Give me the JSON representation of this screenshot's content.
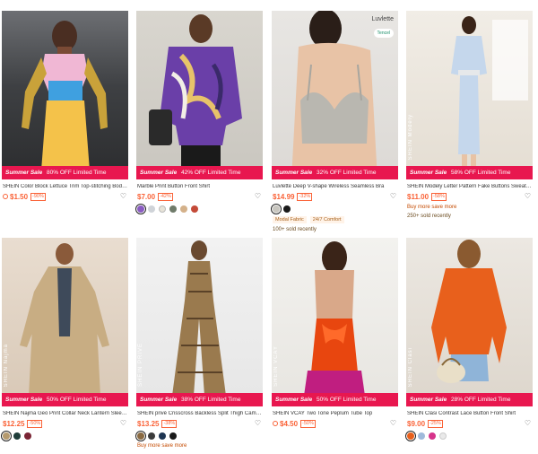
{
  "products": [
    {
      "banner_sale": "Summer Sale",
      "banner_off": "80% OFF Limited Time",
      "title": "SHEIN Color Block Lettuce Trim Top-stitching Bodycon ...",
      "price": "$1.50",
      "discount": "-90%",
      "flash": true,
      "swatches": [],
      "tags": [],
      "link": "",
      "sold": ""
    },
    {
      "banner_sale": "Summer Sale",
      "banner_off": "42% OFF Limited Time",
      "title": "Marble Print Button Front Shirt",
      "price": "$7.00",
      "discount": "-42%",
      "flash": false,
      "swatches": [
        "#8a5cc2",
        "#cfd3d8",
        "#e7e3d8",
        "#6f7b6a",
        "#d4b18a",
        "#c44a38"
      ],
      "tags": [],
      "link": "",
      "sold": ""
    },
    {
      "banner_sale": "Summer Sale",
      "banner_off": "32% OFF Limited Time",
      "title": "Luvlette Deep V-shape Wireless Seamless Bra",
      "price": "$14.99",
      "discount": "-32%",
      "flash": false,
      "swatches": [
        "#c8c6bf",
        "#1a1a1a"
      ],
      "tags": [
        "Modal Fabric",
        "24/7 Comfort"
      ],
      "link": "",
      "sold": "100+ sold recently",
      "brand_logo": "Luvlette",
      "logo_chip": "Tencel"
    },
    {
      "banner_sale": "Summer Sale",
      "banner_off": "58% OFF Limited Time",
      "title": "SHEIN Modely Letter Pattern Fake Buttons Sweater Dress",
      "price": "$11.00",
      "discount": "-58%",
      "flash": false,
      "swatches": [],
      "tags": [],
      "link": "Buy more save more",
      "sold": "250+ sold recently",
      "brandmark": "SHEIN Modely"
    },
    {
      "banner_sale": "Summer Sale",
      "banner_off": "50% OFF Limited Time",
      "title": "SHEIN Najma Geo Print Collar Neck Lantern Sleeve Kaf...",
      "price": "$12.25",
      "discount": "-50%",
      "flash": false,
      "swatches": [
        "#b59a6e",
        "#1f3d3a",
        "#7a2434"
      ],
      "tags": [],
      "link": "",
      "sold": "",
      "brandmark": "SHEIN Najma"
    },
    {
      "banner_sale": "Summer Sale",
      "banner_off": "38% OFF Limited Time",
      "title": "SHEIN privé Crisscross Backless Split Thigh Cami Jum...",
      "price": "$13.25",
      "discount": "-38%",
      "flash": false,
      "swatches": [
        "#8a6a42",
        "#3b3b3b",
        "#1e3552",
        "#1a1a1a"
      ],
      "tags": [],
      "link": "Buy more save more",
      "sold": "",
      "brandmark": "SHEIN PRIVÉ"
    },
    {
      "banner_sale": "Summer Sale",
      "banner_off": "50% OFF Limited Time",
      "title": "SHEIN VCAY Two Tone Peplum Tube Top",
      "price": "$4.50",
      "discount": "-50%",
      "flash": true,
      "swatches": [],
      "tags": [],
      "link": "",
      "sold": "",
      "brandmark": "SHEIN VCAY"
    },
    {
      "banner_sale": "Summer Sale",
      "banner_off": "28% OFF Limited Time",
      "title": "SHEIN Clasi Contrast Lace Button Front Shirt",
      "price": "$9.00",
      "discount": "-25%",
      "flash": false,
      "swatches": [
        "#e8601c",
        "#9fbadb",
        "#d6338a",
        "#e9e9e9"
      ],
      "tags": [],
      "link": "",
      "sold": "",
      "brandmark": "SHEIN Clasi"
    }
  ]
}
